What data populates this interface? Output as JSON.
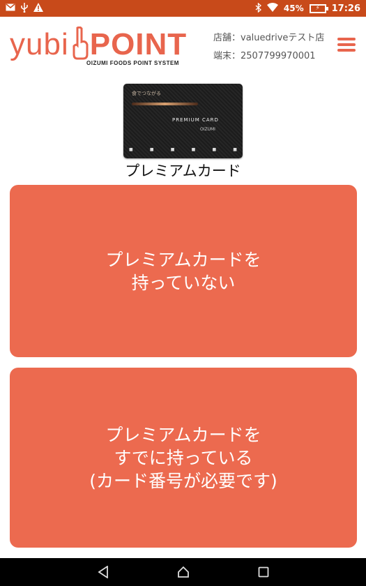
{
  "status_bar": {
    "battery_percent": "45%",
    "time": "17:26",
    "icons": [
      "mail-icon",
      "usb-icon",
      "warning-icon",
      "bluetooth-icon",
      "wifi-icon",
      "battery-charging-icon"
    ]
  },
  "header": {
    "logo_text": "yubi",
    "logo_point": "POINT",
    "logo_subtitle": "OIZUMI FOODS POINT SYSTEM",
    "shop_line": "店舗：valuedriveテスト店",
    "terminal_line": "端末：2507799970001",
    "menu_icon": "hamburger-menu-icon"
  },
  "card": {
    "image_tag": "食でつながる",
    "image_title": "PREMIUM CARD",
    "image_brand": "OIZUMI",
    "caption": "プレミアムカード"
  },
  "options": {
    "no_card_line1": "プレミアムカードを",
    "no_card_line2": "持っていない",
    "have_card_line1": "プレミアムカードを",
    "have_card_line2": "すでに持っている",
    "have_card_line3": "(カード番号が必要です)"
  },
  "nav": {
    "back_icon": "back-icon",
    "home_icon": "home-icon",
    "recents_icon": "recents-icon"
  },
  "colors": {
    "status_bar": "#c84a1a",
    "accent": "#e8654d",
    "button": "#ec6a4f",
    "nav_bar": "#000000"
  }
}
